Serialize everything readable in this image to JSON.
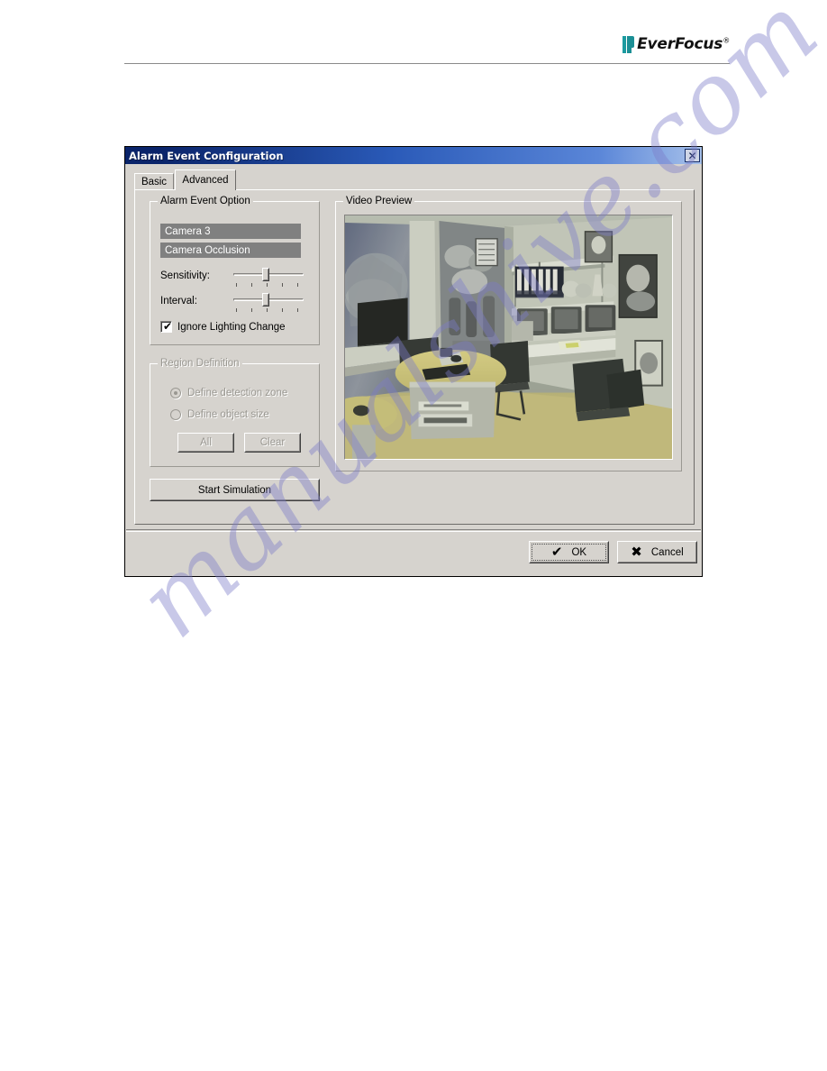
{
  "page": {
    "brand_name": "EverFocus",
    "brand_reg": "®",
    "watermark": "manualshive.com"
  },
  "dialog": {
    "title": "Alarm Event Configuration",
    "close_label": "✕",
    "tabs": [
      {
        "label": "Basic",
        "active": false
      },
      {
        "label": "Advanced",
        "active": true
      }
    ],
    "alarm_event_option": {
      "legend": "Alarm Event Option",
      "camera_item": "Camera 3",
      "event_item": "Camera Occlusion",
      "sensitivity_label": "Sensitivity:",
      "sensitivity_value": 45,
      "sensitivity_ticks": 5,
      "interval_label": "Interval:",
      "interval_value": 45,
      "interval_ticks": 5,
      "ignore_lighting_label": "Ignore Lighting Change",
      "ignore_lighting_checked": true,
      "check_glyph": "✔"
    },
    "region_definition": {
      "legend": "Region Definition",
      "enabled": false,
      "option_zone": "Define detection zone",
      "option_size": "Define object size",
      "selected_option": "Define detection zone",
      "all_label": "All",
      "clear_label": "Clear"
    },
    "start_simulation_label": "Start Simulation",
    "video_preview": {
      "legend": "Video Preview"
    },
    "footer": {
      "ok_label": "OK",
      "ok_glyph": "✔",
      "cancel_label": "Cancel",
      "cancel_glyph": "✖"
    }
  },
  "colors": {
    "title_bar_start": "#0a246a",
    "title_bar_end": "#a6c0ea",
    "dialog_face": "#d6d3ce",
    "list_selection": "#808080",
    "disabled_text": "#9a9892",
    "brand_teal": "#1b8f95",
    "watermark": "#7b7dc8"
  }
}
